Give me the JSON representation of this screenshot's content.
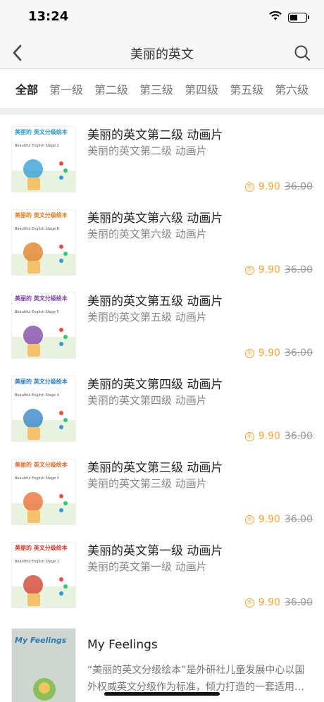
{
  "status": {
    "time": "13:24"
  },
  "nav": {
    "title": "美丽的英文",
    "back_icon": "chevron-left-icon",
    "search_icon": "search-icon"
  },
  "tabs": [
    "全部",
    "第一级",
    "第二级",
    "第三级",
    "第四级",
    "第五级",
    "第六级"
  ],
  "active_tab": "全部",
  "items": [
    {
      "title": "美丽的英文第二级 动画片",
      "subtitle": "美丽的英文第二级 动画片",
      "price": "9.90",
      "old_price": "36.00",
      "cover_title": "美丽的 英文分级绘本",
      "cover_stage": "Beautiful English Stage 2",
      "accent": "#2a9bd6"
    },
    {
      "title": "美丽的英文第六级 动画片",
      "subtitle": "美丽的英文第六级 动画片",
      "price": "9.90",
      "old_price": "36.00",
      "cover_title": "美丽的 英文分级绘本",
      "cover_stage": "Beautiful English Stage 6",
      "accent": "#e07b1a"
    },
    {
      "title": "美丽的英文第五级 动画片",
      "subtitle": "美丽的英文第五级 动画片",
      "price": "9.90",
      "old_price": "36.00",
      "cover_title": "美丽的 英文分级绘本",
      "cover_stage": "Beautiful English Stage 5",
      "accent": "#7b3fa8"
    },
    {
      "title": "美丽的英文第四级 动画片",
      "subtitle": "美丽的英文第四级 动画片",
      "price": "9.90",
      "old_price": "36.00",
      "cover_title": "美丽的 英文分级绘本",
      "cover_stage": "Beautiful English Stage 4",
      "accent": "#2a7fc4"
    },
    {
      "title": "美丽的英文第三级 动画片",
      "subtitle": "美丽的英文第三级 动画片",
      "price": "9.90",
      "old_price": "36.00",
      "cover_title": "美丽的 英文分级绘本",
      "cover_stage": "Beautiful English Stage 3",
      "accent": "#e86a2a"
    },
    {
      "title": "美丽的英文第一级 动画片",
      "subtitle": "美丽的英文第一级 动画片",
      "price": "9.90",
      "old_price": "36.00",
      "cover_title": "美丽的 英文分级绘本",
      "cover_stage": "Beautiful English Stage 1",
      "accent": "#d23a2a"
    }
  ],
  "last_item": {
    "title": "My Feelings",
    "description": "“美丽的英文分级绘本”是外研社儿童发展中心以国外权威英文分级作为标准，倾力打造的一套适用…",
    "cover_title": "My Feelings"
  },
  "colors": {
    "price": "#f4a532",
    "active_tab": "#222222"
  }
}
